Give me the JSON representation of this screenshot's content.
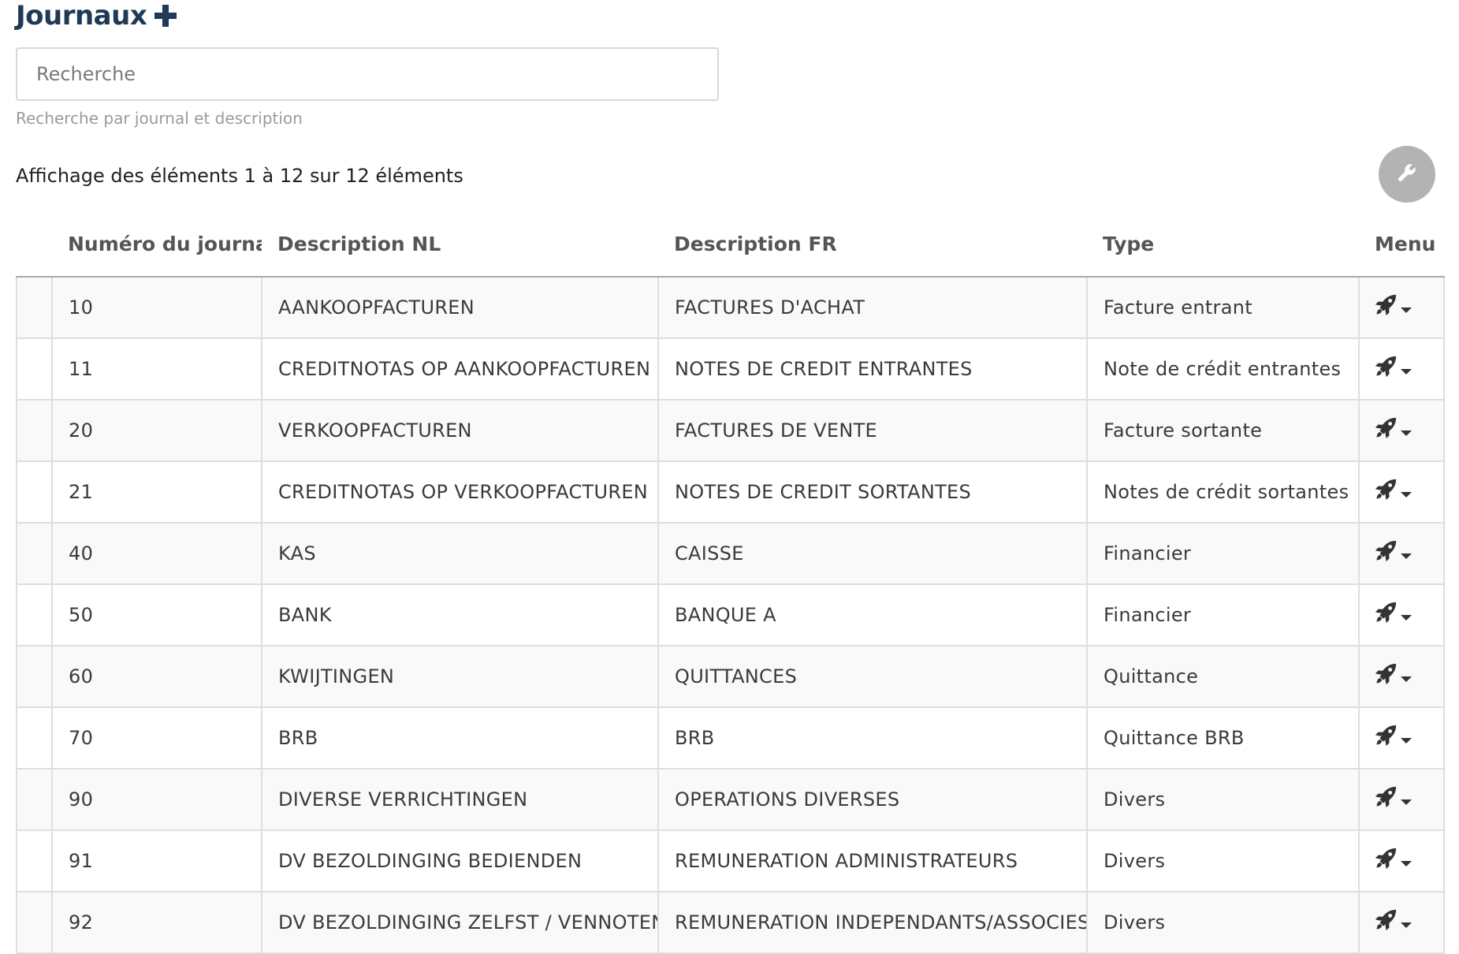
{
  "header": {
    "title": "Journaux"
  },
  "search": {
    "placeholder": "Recherche",
    "value": "",
    "help": "Recherche par journal et description"
  },
  "results": {
    "info": "Affichage des éléments 1 à 12 sur 12 éléments"
  },
  "table": {
    "columns": [
      "",
      "Numéro du journal",
      "Description NL",
      "Description FR",
      "Type",
      "Menu"
    ],
    "rows": [
      {
        "number": "10",
        "desc_nl": "AANKOOPFACTUREN",
        "desc_fr": "FACTURES D'ACHAT",
        "type": "Facture entrant"
      },
      {
        "number": "11",
        "desc_nl": "CREDITNOTAS OP AANKOOPFACTUREN",
        "desc_fr": "NOTES DE CREDIT ENTRANTES",
        "type": "Note de crédit entrantes"
      },
      {
        "number": "20",
        "desc_nl": "VERKOOPFACTUREN",
        "desc_fr": "FACTURES DE VENTE",
        "type": "Facture sortante"
      },
      {
        "number": "21",
        "desc_nl": "CREDITNOTAS OP VERKOOPFACTUREN",
        "desc_fr": "NOTES DE CREDIT SORTANTES",
        "type": "Notes de crédit sortantes"
      },
      {
        "number": "40",
        "desc_nl": "KAS",
        "desc_fr": "CAISSE",
        "type": "Financier"
      },
      {
        "number": "50",
        "desc_nl": "BANK",
        "desc_fr": "BANQUE A",
        "type": "Financier"
      },
      {
        "number": "60",
        "desc_nl": "KWIJTINGEN",
        "desc_fr": "QUITTANCES",
        "type": "Quittance"
      },
      {
        "number": "70",
        "desc_nl": "BRB",
        "desc_fr": "BRB",
        "type": "Quittance BRB"
      },
      {
        "number": "90",
        "desc_nl": "DIVERSE VERRICHTINGEN",
        "desc_fr": "OPERATIONS DIVERSES",
        "type": "Divers"
      },
      {
        "number": "91",
        "desc_nl": "DV BEZOLDINGING BEDIENDEN",
        "desc_fr": "REMUNERATION ADMINISTRATEURS",
        "type": "Divers"
      },
      {
        "number": "92",
        "desc_nl": "DV BEZOLDINGING ZELFST / VENNOTEN",
        "desc_fr": "REMUNERATION INDEPENDANTS/ASSOCIES",
        "type": "Divers"
      }
    ]
  },
  "icons": {
    "add": "plus-icon",
    "settings": "wrench-icon",
    "row_menu": "rocket-icon",
    "row_menu_caret": "caret-down-icon"
  },
  "colors": {
    "title": "#1f3a56",
    "settings_button": "#b3b3b3",
    "icon": "#333333"
  }
}
